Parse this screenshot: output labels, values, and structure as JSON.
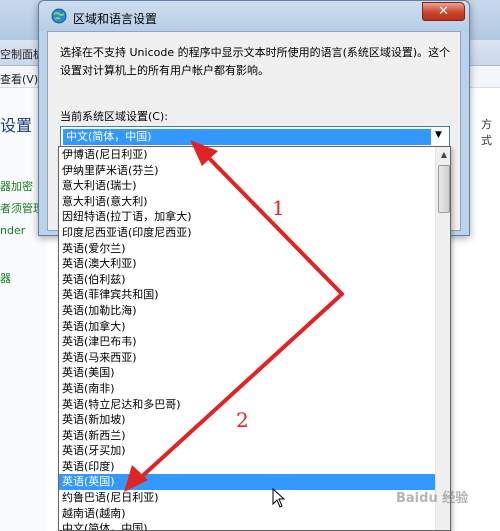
{
  "background_window": {
    "address_text": "空制面板",
    "menu_text": "查看(V)",
    "heading": "设置",
    "right_text": "方式",
    "links": [
      "器加密",
      "者须管理",
      "nder",
      "器"
    ]
  },
  "dialog": {
    "title": "区域和语言设置",
    "close_label": "✕",
    "description": "选择在不支持 Unicode 的程序中显示文本时所使用的语言(系统区域设置)。这个设置对计算机上的所有用户帐户都有影响。",
    "field_label": "当前系统区域设置(C):",
    "combo_value": "中文(简体，中国)",
    "combo_arrow": "▼"
  },
  "dropdown": {
    "items": [
      "伊博语(尼日利亚)",
      "伊纳里萨米语(芬兰)",
      "意大利语(瑞士)",
      "意大利语(意大利)",
      "因纽特语(拉丁语，加拿大)",
      "印度尼西亚语(印度尼西亚)",
      "英语(爱尔兰)",
      "英语(澳大利亚)",
      "英语(伯利兹)",
      "英语(菲律宾共和国)",
      "英语(加勒比海)",
      "英语(加拿大)",
      "英语(津巴布韦)",
      "英语(马来西亚)",
      "英语(美国)",
      "英语(南非)",
      "英语(特立尼达和多巴哥)",
      "英语(新加坡)",
      "英语(新西兰)",
      "英语(牙买加)",
      "英语(印度)",
      "英语(英国)",
      "约鲁巴语(尼日利亚)",
      "越南语(越南)",
      "中文(简体，中国)"
    ],
    "selected_index": 21,
    "scroll_up": "▲"
  },
  "annotations": {
    "label_1": "1",
    "label_2": "2",
    "color": "#e02424"
  },
  "watermark": "Baidu 经验"
}
